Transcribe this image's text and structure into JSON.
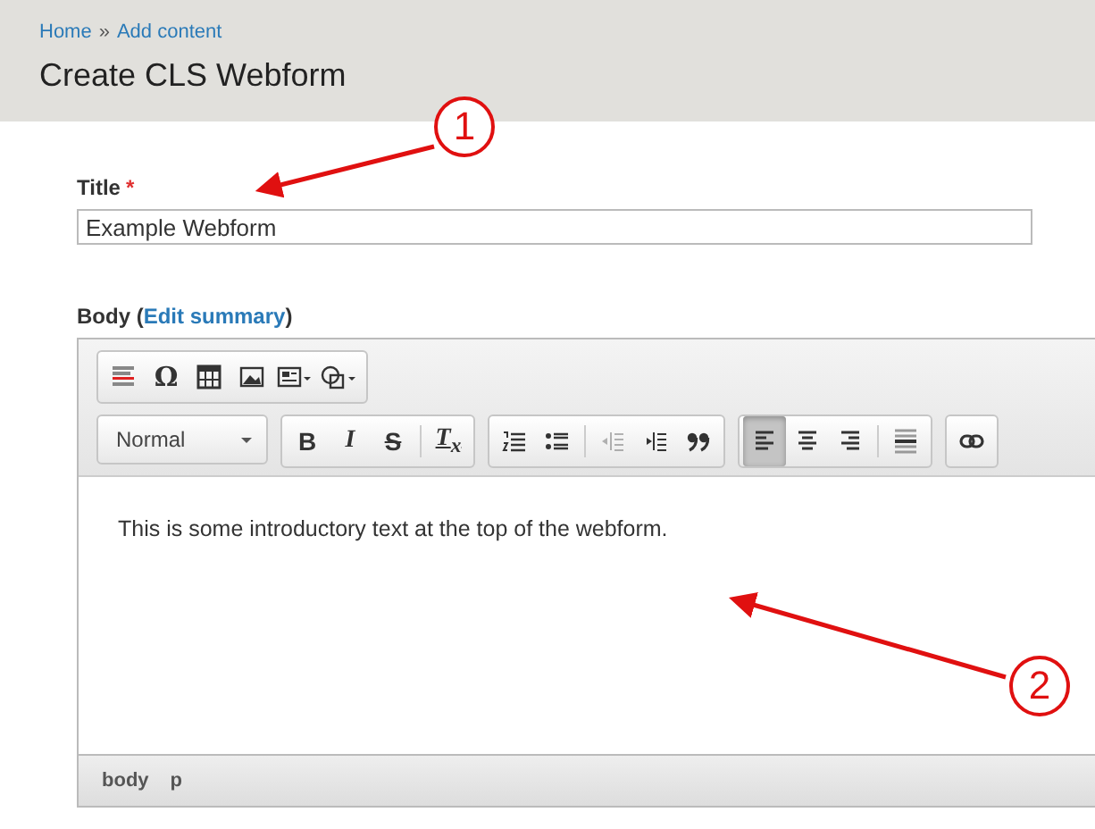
{
  "breadcrumb": [
    {
      "label": "Home"
    },
    {
      "label": "Add content"
    }
  ],
  "breadcrumb_separator": "»",
  "page_title": "Create CLS Webform",
  "title_field": {
    "label": "Title",
    "required_mark": "*",
    "value": "Example Webform"
  },
  "body_field": {
    "label": "Body",
    "link": "Edit summary",
    "open_paren": "(",
    "close_paren": ")"
  },
  "toolbar_row_1": [
    {
      "buttons": [
        {
          "kind": "hr",
          "selected": false,
          "disabled": false
        },
        {
          "kind": "text",
          "label": "Ω",
          "selected": false,
          "disabled": false
        },
        {
          "kind": "table",
          "selected": false,
          "disabled": false
        },
        {
          "kind": "image",
          "selected": false,
          "disabled": false
        },
        {
          "kind": "template",
          "selected": false,
          "disabled": false
        },
        {
          "kind": "shapes",
          "selected": false,
          "disabled": false
        }
      ]
    }
  ],
  "format_dropdown": {
    "value": "Normal"
  },
  "toolbar_row_2": [
    {
      "buttons": [
        {
          "kind": "bold",
          "label": "B",
          "selected": false,
          "disabled": false
        },
        {
          "kind": "italic",
          "label": "I",
          "selected": false,
          "disabled": false
        },
        {
          "kind": "strike",
          "label": "S",
          "selected": false,
          "disabled": false
        },
        {
          "kind": "separator"
        },
        {
          "kind": "clear",
          "label": "T$_{x}$",
          "selected": false,
          "disabled": false
        }
      ]
    },
    {
      "buttons": [
        {
          "kind": "ol",
          "selected": false,
          "disabled": false
        },
        {
          "kind": "ul",
          "selected": false,
          "disabled": false
        },
        {
          "kind": "separator"
        },
        {
          "kind": "outdent",
          "selected": false,
          "disabled": true
        },
        {
          "kind": "indent",
          "selected": false,
          "disabled": false
        },
        {
          "kind": "quote",
          "selected": false,
          "disabled": false
        }
      ]
    },
    {
      "buttons": [
        {
          "kind": "align-left",
          "selected": true,
          "disabled": false
        },
        {
          "kind": "align-center",
          "selected": false,
          "disabled": false
        },
        {
          "kind": "align-right",
          "selected": false,
          "disabled": false
        },
        {
          "kind": "separator"
        },
        {
          "kind": "justify",
          "selected": false,
          "disabled": false
        }
      ]
    },
    {
      "buttons": [
        {
          "kind": "link",
          "selected": false,
          "disabled": false
        }
      ]
    }
  ],
  "editor_text": "This is some introductory text at the top of the webform.",
  "element_path": [
    {
      "label": "body"
    },
    {
      "label": "p"
    }
  ],
  "annotations": [
    {
      "label": "1"
    },
    {
      "label": "2"
    }
  ]
}
